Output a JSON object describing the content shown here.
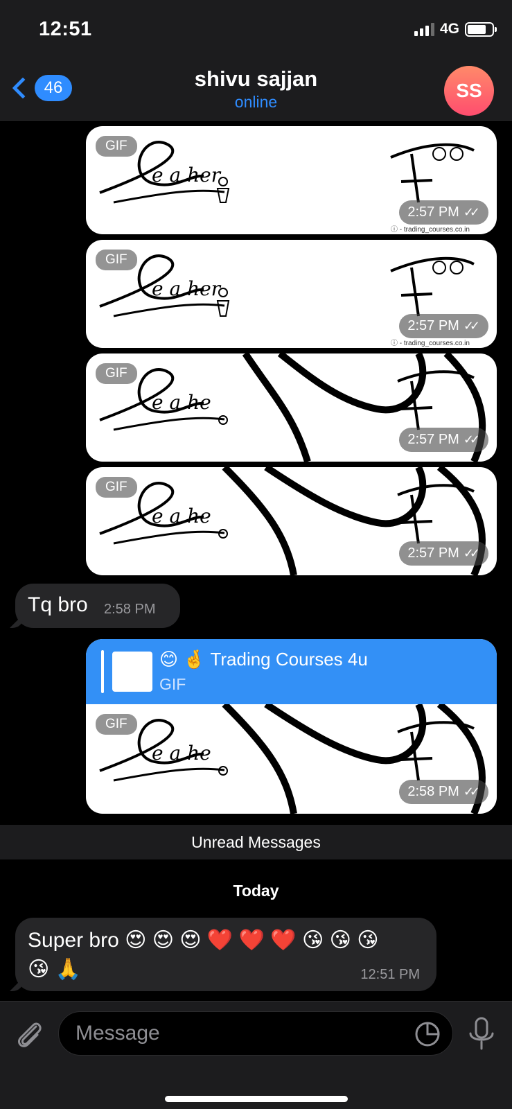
{
  "status_bar": {
    "time": "12:51",
    "network": "4G"
  },
  "header": {
    "back_count": "46",
    "title": "shivu sajjan",
    "subtitle": "online",
    "avatar_initials": "SS"
  },
  "gif_label": "GIF",
  "gif_messages": [
    {
      "time": "2:57 PM"
    },
    {
      "time": "2:57 PM"
    },
    {
      "time": "2:57 PM"
    },
    {
      "time": "2:57 PM"
    }
  ],
  "incoming_1": {
    "text": "Tq bro",
    "time": "2:58 PM"
  },
  "reply_message": {
    "title": "😊 🤞 Trading Courses 4u",
    "sub": "GIF",
    "time": "2:58 PM"
  },
  "unread_label": "Unread Messages",
  "date_label": "Today",
  "incoming_2": {
    "text": "Super bro 😍 😍 😍 ❤️ ❤️ ❤️ 😘 😘 😘 😘 🙏",
    "time": "12:51 PM"
  },
  "input": {
    "placeholder": "Message"
  },
  "colors": {
    "accent": "#2f8cff",
    "bubble_out": "#3390f6",
    "bubble_in": "#262628",
    "avatar": "#ff5a6e"
  }
}
